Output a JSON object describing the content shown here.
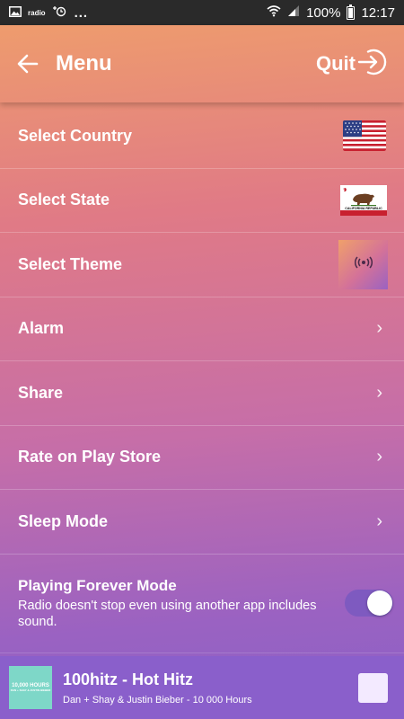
{
  "status_bar": {
    "radio_label": "radio",
    "dots": "...",
    "battery": "100%",
    "time": "12:17"
  },
  "header": {
    "title": "Menu",
    "quit_label": "Quit"
  },
  "menu": {
    "items": [
      {
        "label": "Select Country",
        "right": "us-flag"
      },
      {
        "label": "Select State",
        "right": "california-flag"
      },
      {
        "label": "Select Theme",
        "right": "theme-thumbnail"
      },
      {
        "label": "Alarm",
        "right": "chevron"
      },
      {
        "label": "Share",
        "right": "chevron"
      },
      {
        "label": "Rate on Play Store",
        "right": "chevron"
      },
      {
        "label": "Sleep Mode",
        "right": "chevron"
      }
    ],
    "chevron": "›",
    "california_flag_text": "CALIFORNIA REPUBLIC"
  },
  "forever_mode": {
    "title": "Playing Forever Mode",
    "description": "Radio doesn't stop even using another app includes sound.",
    "enabled": true
  },
  "player": {
    "title": "100hitz - Hot Hitz",
    "artist": "Dan + Shay & Justin Bieber - 10 000 Hours",
    "album_art_text": "10,000 HOURS",
    "album_art_subtext": "DAN + SHAY & JUSTIN BIEBER"
  },
  "colors": {
    "player_bg": "#8a5fcb",
    "toggle_on": "#7e5ac0"
  }
}
